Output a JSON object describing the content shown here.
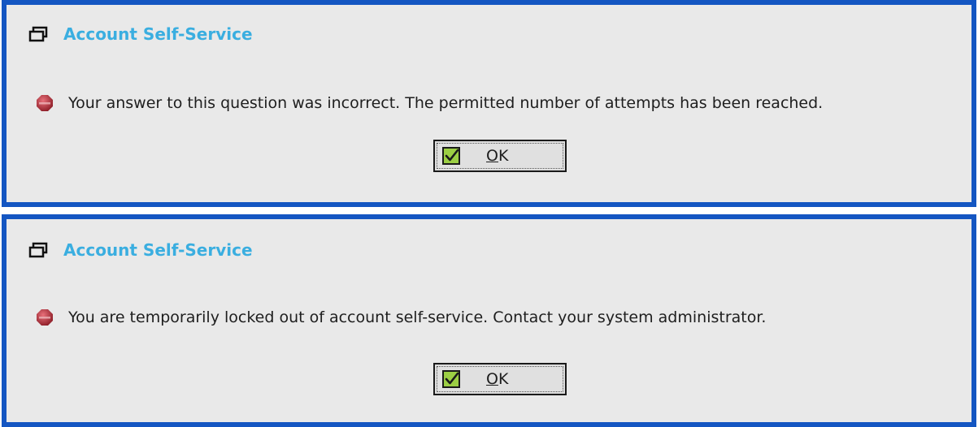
{
  "colors": {
    "frame_border": "#1456c2",
    "dialog_background": "#e9e9e9",
    "title_text": "#3aaee0",
    "stop_icon": "#b0303a",
    "check_icon": "#7cbf2e"
  },
  "dialogs": [
    {
      "title": "Account Self-Service",
      "title_icon": "window-icon",
      "status_icon": "stop-icon",
      "message": "Your answer to this question was incorrect. The permitted number of attempts has been reached.",
      "button": {
        "icon": "checkmark-icon",
        "mnemonic": "O",
        "label_rest": "K"
      }
    },
    {
      "title": "Account Self-Service",
      "title_icon": "window-icon",
      "status_icon": "stop-icon",
      "message": "You are temporarily locked out of account self-service. Contact your system administrator.",
      "button": {
        "icon": "checkmark-icon",
        "mnemonic": "O",
        "label_rest": "K"
      }
    }
  ]
}
